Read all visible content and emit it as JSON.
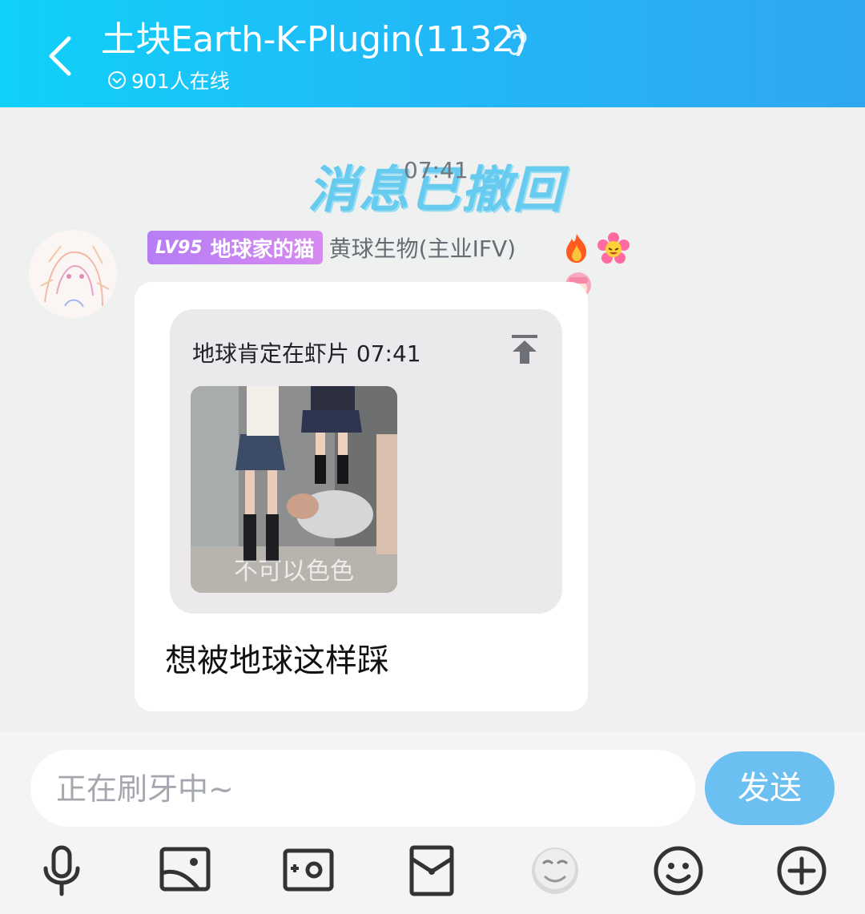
{
  "header": {
    "title": "土块Earth-K-Plugin(1132)",
    "online": "901人在线",
    "icons": [
      "back-icon",
      "ear-icon",
      "online-icon"
    ]
  },
  "chat": {
    "recall_sticker": "消息已撤回",
    "timestamp": "07:41",
    "message": {
      "level": "LV95",
      "title_tag": "地球家的猫",
      "sender": "黄球生物(主业IFV)",
      "badges": [
        "fire-badge-icon",
        "flower-badge-icon",
        "girl-badge-icon"
      ],
      "quote": {
        "header": "地球肯定在虾片 07:41",
        "image_caption": "不可以色色"
      },
      "text": "想被地球这样踩"
    }
  },
  "composer": {
    "placeholder": "正在刷牙中~",
    "send_label": "发送"
  },
  "toolbar": [
    "mic-icon",
    "image-icon",
    "camera-icon",
    "red-packet-icon",
    "sticker-icon",
    "emoji-icon",
    "plus-icon"
  ],
  "colors": {
    "header_start": "#10d0f8",
    "header_end": "#2fa6f1",
    "send_button": "#6bbff1",
    "level_tag": "#b67df5"
  }
}
